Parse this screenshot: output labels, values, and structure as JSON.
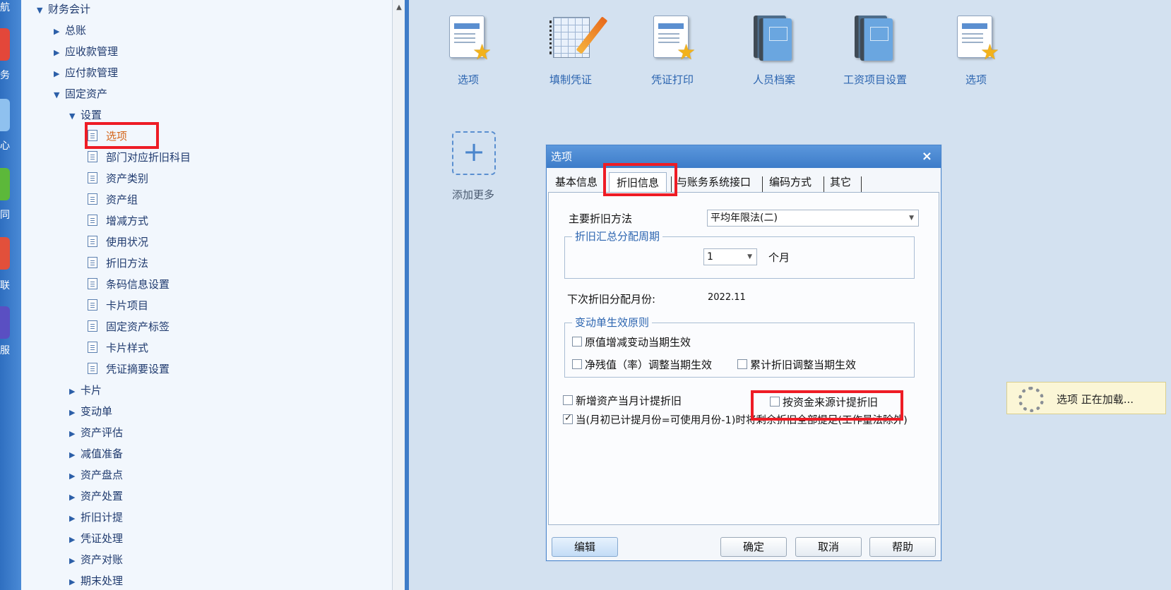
{
  "side_strip": [
    "航",
    "务",
    "心",
    "同",
    "联",
    "服"
  ],
  "tree": {
    "root": "财务会计",
    "items": [
      {
        "label": "总账",
        "level": 1,
        "state": "collapsed"
      },
      {
        "label": "应收款管理",
        "level": 1,
        "state": "collapsed"
      },
      {
        "label": "应付款管理",
        "level": 1,
        "state": "collapsed"
      },
      {
        "label": "固定资产",
        "level": 1,
        "state": "expanded"
      },
      {
        "label": "设置",
        "level": 2,
        "state": "expanded"
      },
      {
        "label": "选项",
        "level": 3,
        "state": "leaf",
        "selected": true
      },
      {
        "label": "部门对应折旧科目",
        "level": 3,
        "state": "leaf"
      },
      {
        "label": "资产类别",
        "level": 3,
        "state": "leaf"
      },
      {
        "label": "资产组",
        "level": 3,
        "state": "leaf"
      },
      {
        "label": "增减方式",
        "level": 3,
        "state": "leaf"
      },
      {
        "label": "使用状况",
        "level": 3,
        "state": "leaf"
      },
      {
        "label": "折旧方法",
        "level": 3,
        "state": "leaf"
      },
      {
        "label": "条码信息设置",
        "level": 3,
        "state": "leaf"
      },
      {
        "label": "卡片项目",
        "level": 3,
        "state": "leaf"
      },
      {
        "label": "固定资产标签",
        "level": 3,
        "state": "leaf"
      },
      {
        "label": "卡片样式",
        "level": 3,
        "state": "leaf"
      },
      {
        "label": "凭证摘要设置",
        "level": 3,
        "state": "leaf"
      },
      {
        "label": "卡片",
        "level": 2,
        "state": "collapsed"
      },
      {
        "label": "变动单",
        "level": 2,
        "state": "collapsed"
      },
      {
        "label": "资产评估",
        "level": 2,
        "state": "collapsed"
      },
      {
        "label": "减值准备",
        "level": 2,
        "state": "collapsed"
      },
      {
        "label": "资产盘点",
        "level": 2,
        "state": "collapsed"
      },
      {
        "label": "资产处置",
        "level": 2,
        "state": "collapsed"
      },
      {
        "label": "折旧计提",
        "level": 2,
        "state": "collapsed"
      },
      {
        "label": "凭证处理",
        "level": 2,
        "state": "collapsed"
      },
      {
        "label": "资产对账",
        "level": 2,
        "state": "collapsed"
      },
      {
        "label": "期末处理",
        "level": 2,
        "state": "collapsed"
      }
    ]
  },
  "shortcuts": [
    {
      "label": "选项",
      "icon": "document-star-icon"
    },
    {
      "label": "填制凭证",
      "icon": "notebook-pencil-icon"
    },
    {
      "label": "凭证打印",
      "icon": "document-star-icon"
    },
    {
      "label": "人员档案",
      "icon": "books-icon"
    },
    {
      "label": "工资项目设置",
      "icon": "books-icon"
    },
    {
      "label": "选项",
      "icon": "document-star-icon"
    }
  ],
  "add_more": {
    "symbol": "+",
    "label": "添加更多"
  },
  "dialog": {
    "title": "选项",
    "close": "×",
    "tabs": [
      "基本信息",
      "折旧信息",
      "与账务系统接口",
      "编码方式",
      "其它"
    ],
    "active_tab": "折旧信息",
    "main_method_label": "主要折旧方法",
    "main_method_value": "平均年限法(二)",
    "period_group_title": "折旧汇总分配周期",
    "period_value": "1",
    "period_unit": "个月",
    "next_month_label": "下次折旧分配月份:",
    "next_month_value": "2022.11",
    "change_group_title": "变动单生效原则",
    "checks": {
      "original_value": {
        "label": "原值增减变动当期生效",
        "checked": false
      },
      "net_residual": {
        "label": "净残值（率）调整当期生效",
        "checked": false
      },
      "accum_depr": {
        "label": "累计折旧调整当期生效",
        "checked": false
      },
      "new_asset": {
        "label": "新增资产当月计提折旧",
        "checked": false
      },
      "by_fund_source": {
        "label": "按资金来源计提折旧",
        "checked": false
      },
      "full_depr": {
        "label": "当(月初已计提月份=可使用月份-1)时将剩余折旧全部提足(工作量法除外)",
        "checked": true
      }
    },
    "buttons": {
      "edit": "编辑",
      "ok": "确定",
      "cancel": "取消",
      "help": "帮助"
    }
  },
  "toast": {
    "text": "选项  正在加载..."
  },
  "colors": {
    "highlight": "#ee1c25",
    "accent": "#3d7cc9",
    "selected_text": "#d4661a"
  }
}
